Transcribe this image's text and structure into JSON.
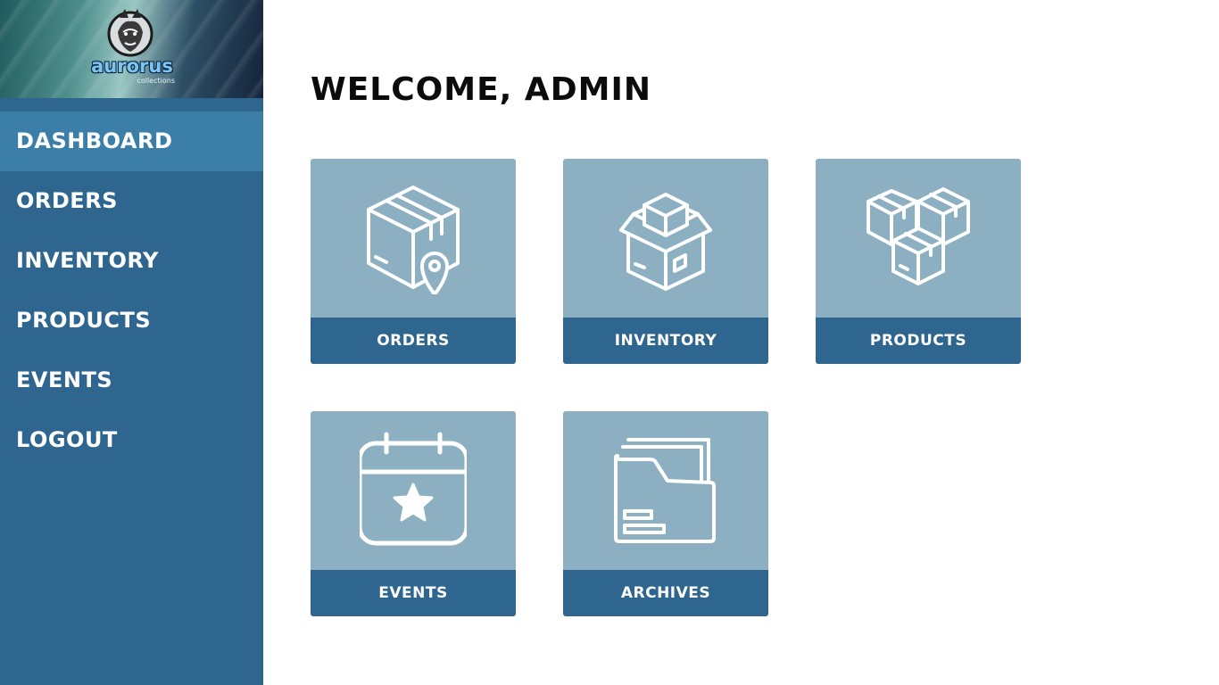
{
  "brand": {
    "name": "aurorus",
    "tagline": "collections",
    "logo_icon": "dragon-emblem-icon"
  },
  "sidebar": {
    "items": [
      {
        "label": "DASHBOARD",
        "active": true
      },
      {
        "label": "ORDERS",
        "active": false
      },
      {
        "label": "INVENTORY",
        "active": false
      },
      {
        "label": "PRODUCTS",
        "active": false
      },
      {
        "label": "EVENTS",
        "active": false
      },
      {
        "label": "LOGOUT",
        "active": false
      }
    ]
  },
  "main": {
    "title": "WELCOME, ADMIN",
    "tiles": [
      {
        "label": "ORDERS",
        "icon": "package-location-icon"
      },
      {
        "label": "INVENTORY",
        "icon": "open-box-icon"
      },
      {
        "label": "PRODUCTS",
        "icon": "stacked-boxes-icon"
      },
      {
        "label": "EVENTS",
        "icon": "calendar-star-icon"
      },
      {
        "label": "ARCHIVES",
        "icon": "folder-documents-icon"
      }
    ]
  },
  "colors": {
    "sidebar_bg": "#2e6690",
    "sidebar_active": "#3b7ea8",
    "tile_bg": "#8cb0c1",
    "tile_label_bg": "#2e6690",
    "title_text": "#0b0b0b"
  }
}
